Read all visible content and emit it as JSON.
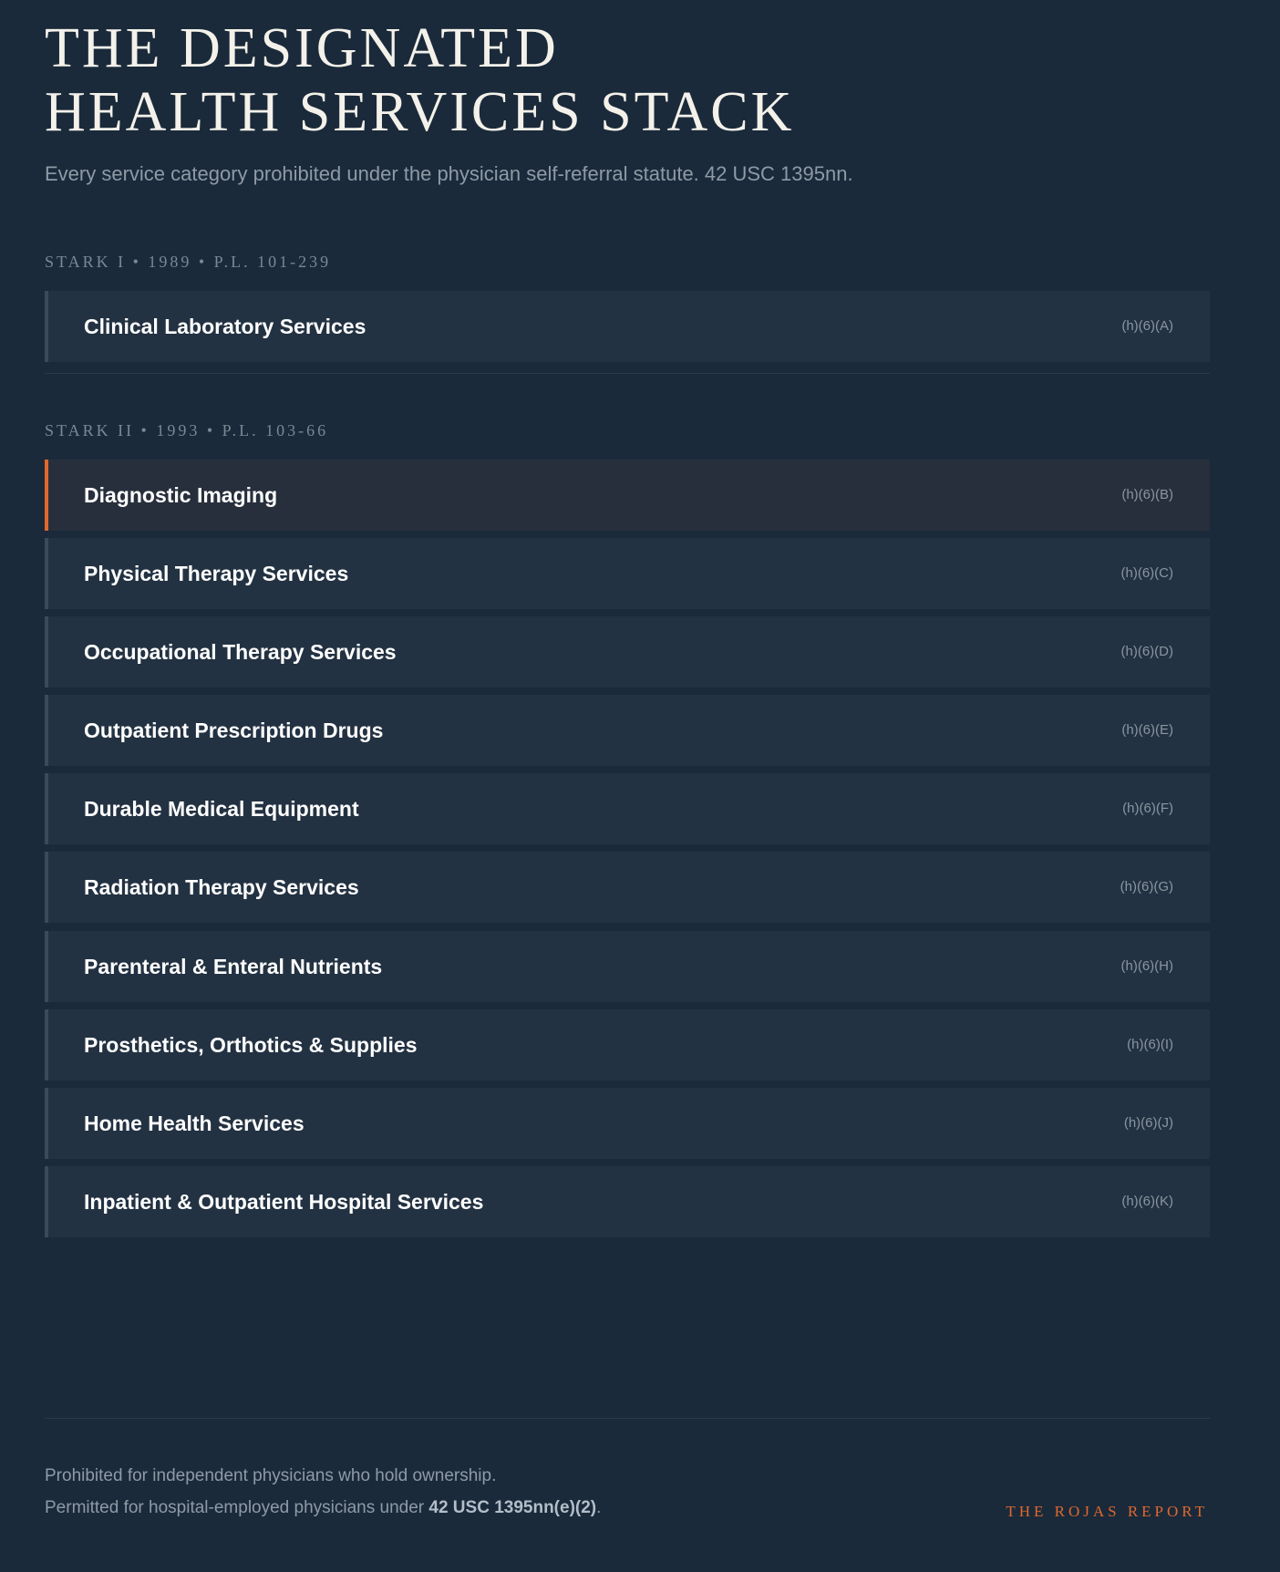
{
  "header": {
    "title_line1": "THE DESIGNATED",
    "title_line2": "HEALTH SERVICES STACK",
    "subtitle": "Every service category prohibited under the physician self-referral statute. 42 USC 1395nn."
  },
  "sections": [
    {
      "label": "STARK I • 1989 • P.L. 101-239",
      "rows": [
        {
          "name": "Clinical Laboratory Services",
          "cite": "(h)(6)(A)"
        }
      ]
    },
    {
      "label": "STARK II • 1993 • P.L. 103-66",
      "rows": [
        {
          "name": "Diagnostic Imaging",
          "cite": "(h)(6)(B)"
        },
        {
          "name": "Physical Therapy Services",
          "cite": "(h)(6)(C)"
        },
        {
          "name": "Occupational Therapy Services",
          "cite": "(h)(6)(D)"
        },
        {
          "name": "Outpatient Prescription Drugs",
          "cite": "(h)(6)(E)"
        },
        {
          "name": "Durable Medical Equipment",
          "cite": "(h)(6)(F)"
        },
        {
          "name": "Radiation Therapy Services",
          "cite": "(h)(6)(G)"
        },
        {
          "name": "Parenteral & Enteral Nutrients",
          "cite": "(h)(6)(H)"
        },
        {
          "name": "Prosthetics, Orthotics & Supplies",
          "cite": "(h)(6)(I)"
        },
        {
          "name": "Home Health Services",
          "cite": "(h)(6)(J)"
        },
        {
          "name": "Inpatient & Outpatient Hospital Services",
          "cite": "(h)(6)(K)"
        }
      ]
    }
  ],
  "footer": {
    "line1": "Prohibited for independent physicians who hold ownership.",
    "line2_prefix": "Permitted for hospital-employed physicians under ",
    "line2_bold": "42 USC 1395nn(e)(2)",
    "line2_suffix": ".",
    "brand": "THE ROJAS REPORT"
  },
  "colors": {
    "background": "#1a2a3a",
    "row": "#233242",
    "row_highlight": "#282f3c",
    "accent": "#e0682f"
  }
}
